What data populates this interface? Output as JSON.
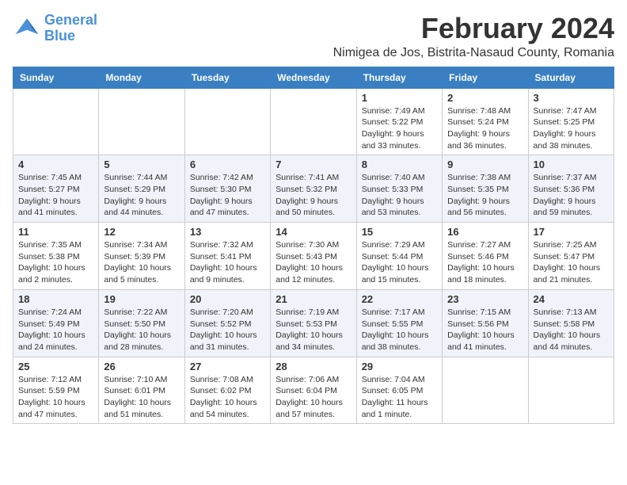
{
  "logo": {
    "line1": "General",
    "line2": "Blue"
  },
  "title": "February 2024",
  "location": "Nimigea de Jos, Bistrita-Nasaud County, Romania",
  "weekdays": [
    "Sunday",
    "Monday",
    "Tuesday",
    "Wednesday",
    "Thursday",
    "Friday",
    "Saturday"
  ],
  "weeks": [
    [
      {
        "day": "",
        "info": ""
      },
      {
        "day": "",
        "info": ""
      },
      {
        "day": "",
        "info": ""
      },
      {
        "day": "",
        "info": ""
      },
      {
        "day": "1",
        "info": "Sunrise: 7:49 AM\nSunset: 5:22 PM\nDaylight: 9 hours\nand 33 minutes."
      },
      {
        "day": "2",
        "info": "Sunrise: 7:48 AM\nSunset: 5:24 PM\nDaylight: 9 hours\nand 36 minutes."
      },
      {
        "day": "3",
        "info": "Sunrise: 7:47 AM\nSunset: 5:25 PM\nDaylight: 9 hours\nand 38 minutes."
      }
    ],
    [
      {
        "day": "4",
        "info": "Sunrise: 7:45 AM\nSunset: 5:27 PM\nDaylight: 9 hours\nand 41 minutes."
      },
      {
        "day": "5",
        "info": "Sunrise: 7:44 AM\nSunset: 5:29 PM\nDaylight: 9 hours\nand 44 minutes."
      },
      {
        "day": "6",
        "info": "Sunrise: 7:42 AM\nSunset: 5:30 PM\nDaylight: 9 hours\nand 47 minutes."
      },
      {
        "day": "7",
        "info": "Sunrise: 7:41 AM\nSunset: 5:32 PM\nDaylight: 9 hours\nand 50 minutes."
      },
      {
        "day": "8",
        "info": "Sunrise: 7:40 AM\nSunset: 5:33 PM\nDaylight: 9 hours\nand 53 minutes."
      },
      {
        "day": "9",
        "info": "Sunrise: 7:38 AM\nSunset: 5:35 PM\nDaylight: 9 hours\nand 56 minutes."
      },
      {
        "day": "10",
        "info": "Sunrise: 7:37 AM\nSunset: 5:36 PM\nDaylight: 9 hours\nand 59 minutes."
      }
    ],
    [
      {
        "day": "11",
        "info": "Sunrise: 7:35 AM\nSunset: 5:38 PM\nDaylight: 10 hours\nand 2 minutes."
      },
      {
        "day": "12",
        "info": "Sunrise: 7:34 AM\nSunset: 5:39 PM\nDaylight: 10 hours\nand 5 minutes."
      },
      {
        "day": "13",
        "info": "Sunrise: 7:32 AM\nSunset: 5:41 PM\nDaylight: 10 hours\nand 9 minutes."
      },
      {
        "day": "14",
        "info": "Sunrise: 7:30 AM\nSunset: 5:43 PM\nDaylight: 10 hours\nand 12 minutes."
      },
      {
        "day": "15",
        "info": "Sunrise: 7:29 AM\nSunset: 5:44 PM\nDaylight: 10 hours\nand 15 minutes."
      },
      {
        "day": "16",
        "info": "Sunrise: 7:27 AM\nSunset: 5:46 PM\nDaylight: 10 hours\nand 18 minutes."
      },
      {
        "day": "17",
        "info": "Sunrise: 7:25 AM\nSunset: 5:47 PM\nDaylight: 10 hours\nand 21 minutes."
      }
    ],
    [
      {
        "day": "18",
        "info": "Sunrise: 7:24 AM\nSunset: 5:49 PM\nDaylight: 10 hours\nand 24 minutes."
      },
      {
        "day": "19",
        "info": "Sunrise: 7:22 AM\nSunset: 5:50 PM\nDaylight: 10 hours\nand 28 minutes."
      },
      {
        "day": "20",
        "info": "Sunrise: 7:20 AM\nSunset: 5:52 PM\nDaylight: 10 hours\nand 31 minutes."
      },
      {
        "day": "21",
        "info": "Sunrise: 7:19 AM\nSunset: 5:53 PM\nDaylight: 10 hours\nand 34 minutes."
      },
      {
        "day": "22",
        "info": "Sunrise: 7:17 AM\nSunset: 5:55 PM\nDaylight: 10 hours\nand 38 minutes."
      },
      {
        "day": "23",
        "info": "Sunrise: 7:15 AM\nSunset: 5:56 PM\nDaylight: 10 hours\nand 41 minutes."
      },
      {
        "day": "24",
        "info": "Sunrise: 7:13 AM\nSunset: 5:58 PM\nDaylight: 10 hours\nand 44 minutes."
      }
    ],
    [
      {
        "day": "25",
        "info": "Sunrise: 7:12 AM\nSunset: 5:59 PM\nDaylight: 10 hours\nand 47 minutes."
      },
      {
        "day": "26",
        "info": "Sunrise: 7:10 AM\nSunset: 6:01 PM\nDaylight: 10 hours\nand 51 minutes."
      },
      {
        "day": "27",
        "info": "Sunrise: 7:08 AM\nSunset: 6:02 PM\nDaylight: 10 hours\nand 54 minutes."
      },
      {
        "day": "28",
        "info": "Sunrise: 7:06 AM\nSunset: 6:04 PM\nDaylight: 10 hours\nand 57 minutes."
      },
      {
        "day": "29",
        "info": "Sunrise: 7:04 AM\nSunset: 6:05 PM\nDaylight: 11 hours\nand 1 minute."
      },
      {
        "day": "",
        "info": ""
      },
      {
        "day": "",
        "info": ""
      }
    ]
  ]
}
